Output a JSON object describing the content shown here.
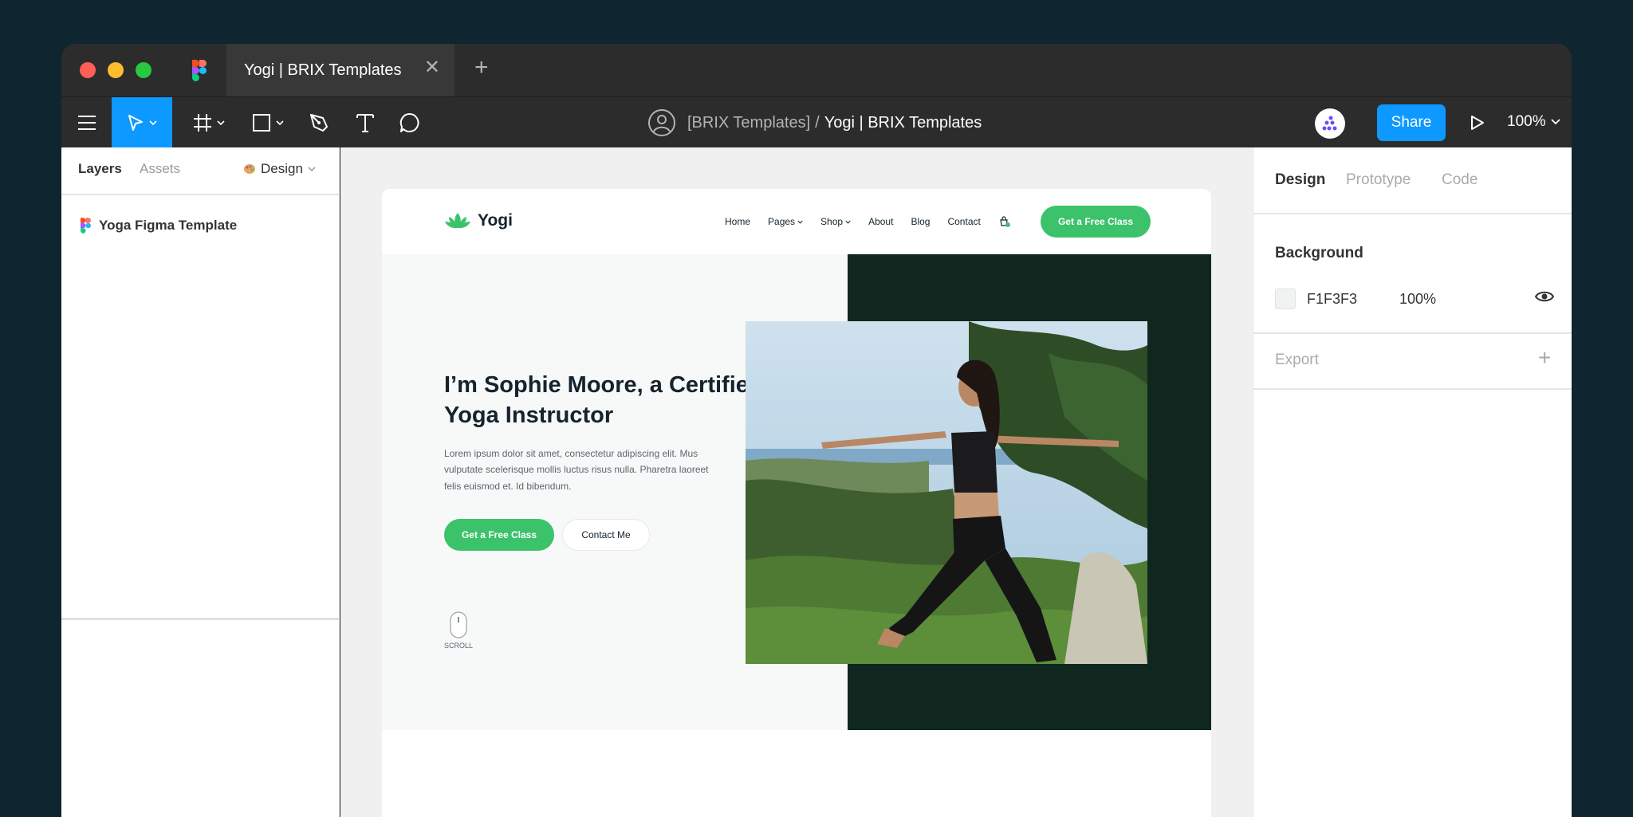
{
  "tab": {
    "title": "Yogi | BRIX Templates",
    "close": "✕",
    "add": "+"
  },
  "breadcrumb": {
    "team": "[BRIX Templates]",
    "separator": "/",
    "file": "Yogi | BRIX Templates"
  },
  "toolbar": {
    "share_label": "Share",
    "zoom": "100%"
  },
  "left_panel": {
    "tabs": {
      "layers": "Layers",
      "assets": "Assets",
      "design": "Design"
    },
    "page_name": "Yoga Figma Template"
  },
  "site": {
    "logo": "Yogi",
    "nav": [
      "Home",
      "Pages",
      "Shop",
      "About",
      "Blog",
      "Contact"
    ],
    "nav_cta": "Get a Free Class",
    "hero_title": "I’m Sophie Moore, a Certified Yoga Instructor",
    "hero_text": "Lorem ipsum dolor sit amet, consectetur adipiscing elit. Mus vulputate scelerisque mollis luctus risus nulla. Pharetra laoreet felis euismod et. Id bibendum.",
    "primary_button": "Get a Free Class",
    "secondary_button": "Contact Me",
    "scroll_label": "SCROLL"
  },
  "right_panel": {
    "tabs": {
      "design": "Design",
      "prototype": "Prototype",
      "code": "Code"
    },
    "background_title": "Background",
    "background_hex": "F1F3F3",
    "background_opacity": "100%",
    "export_title": "Export",
    "export_add": "+"
  },
  "colors": {
    "accent": "#0d99ff",
    "site_green": "#3cc26b",
    "site_dark": "#10271f",
    "page_bg": "#0f2630"
  }
}
